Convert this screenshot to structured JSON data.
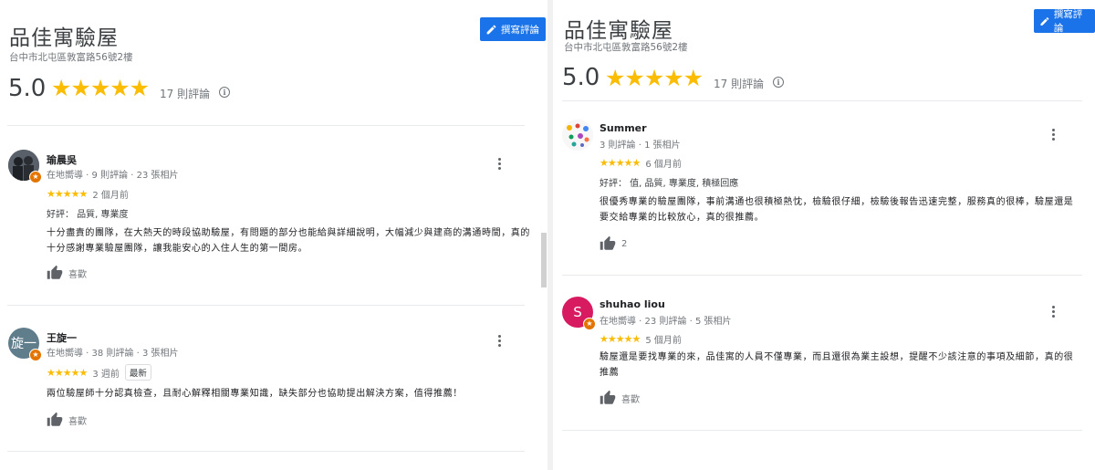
{
  "left": {
    "place_title": "品佳寓驗屋",
    "address": "台中市北屯區敦富路56號2樓",
    "write_review_label": "撰寫評論",
    "rating": "5.0",
    "stars": "★★★★★",
    "review_count": "17 則評論",
    "reviews": [
      {
        "avatar_text": "",
        "name": "瑜晨吳",
        "meta": "在地嚮導 · 9 則評論 · 23 張相片",
        "stars": "★★★★★",
        "time": "2 個月前",
        "praise": "好評： 品質, 專業度",
        "text": "十分盡責的團隊，在大熱天的時段協助驗屋，有問題的部分也能給與詳細說明，大幅減少與建商的溝通時間，真的十分感謝專業驗屋團隊，讓我能安心的入住人生的第一間房。",
        "like_label": "喜歡"
      },
      {
        "avatar_text": "旋一",
        "name": "王旋一",
        "meta": "在地嚮導 · 38 則評論 · 3 張相片",
        "stars": "★★★★★",
        "time": "3 週前",
        "tag": "最新",
        "text": "兩位驗屋師十分認真檢查，且耐心解釋相關專業知識，缺失部分也協助提出解決方案，值得推薦！",
        "like_label": "喜歡"
      }
    ]
  },
  "right": {
    "place_title": "品佳寓驗屋",
    "address": "台中市北屯區敦富路56號2樓",
    "write_review_label": "撰寫評論",
    "rating": "5.0",
    "stars": "★★★★★",
    "review_count": "17 則評論",
    "reviews": [
      {
        "avatar_text": "",
        "name": "Summer",
        "meta": "3 則評論 · 1 張相片",
        "stars": "★★★★★",
        "time": "6 個月前",
        "praise": "好評： 值, 品質, 專業度, 積極回應",
        "text": "很優秀專業的驗屋團隊，事前溝通也很積極熱忱，檢驗很仔細，檢驗後報告迅速完整，服務真的很棒，驗屋還是要交給專業的比較放心，真的很推薦。",
        "like_count": "2"
      },
      {
        "avatar_text": "S",
        "name": "shuhao liou",
        "meta": "在地嚮導 · 23 則評論 · 5 張相片",
        "stars": "★★★★★",
        "time": "5 個月前",
        "text": "驗屋還是要找專業的來，品佳寓的人員不僅專業，而且還很為業主設想，提醒不少該注意的事項及細節，真的很推薦",
        "like_label": "喜歡"
      }
    ]
  },
  "colors": {
    "accent": "#1a73e8",
    "star": "#fbbc04",
    "guide_badge": "#e37400",
    "avatar_pink": "#d81b60"
  }
}
